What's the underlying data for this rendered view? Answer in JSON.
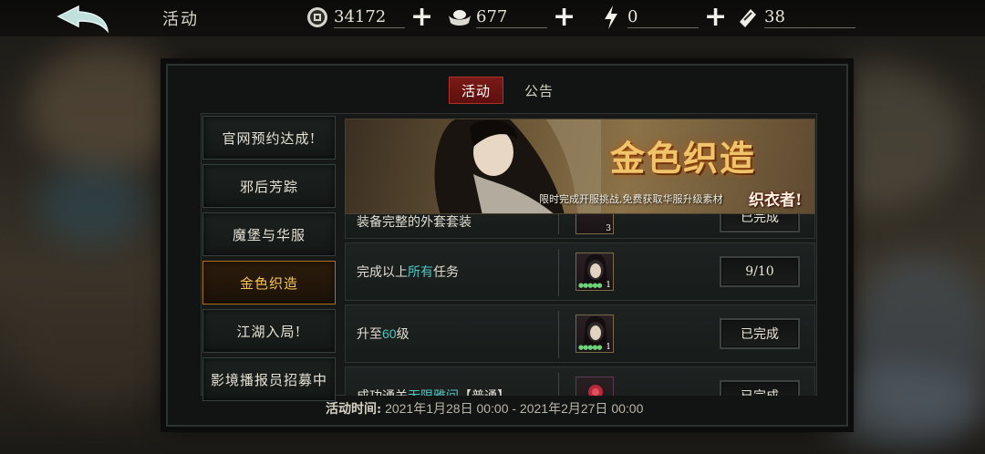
{
  "topbar": {
    "title": "活动",
    "resources": [
      {
        "icon": "coin-icon",
        "value": "34172"
      },
      {
        "icon": "silver-ingot-icon",
        "value": "677"
      },
      {
        "icon": "lightning-icon",
        "value": "0"
      },
      {
        "icon": "ticket-icon",
        "value": "38"
      }
    ],
    "plus_label": "+"
  },
  "tabs": [
    {
      "label": "活动",
      "active": true
    },
    {
      "label": "公告",
      "active": false
    }
  ],
  "sidebar": {
    "items": [
      {
        "label": "官网预约达成!",
        "active": false
      },
      {
        "label": "邪后芳踪",
        "active": false
      },
      {
        "label": "魔堡与华服",
        "active": false
      },
      {
        "label": "金色织造",
        "active": true
      },
      {
        "label": "江湖入局!",
        "active": false
      },
      {
        "label": "影境播报员招募中",
        "active": false
      }
    ]
  },
  "banner": {
    "title": "金色织造",
    "subtitle": "限时完成开服挑战,免费获取华服升级素材",
    "brand": "织衣者!"
  },
  "tasks": [
    {
      "desc_prefix": "装备完整的外套套装",
      "desc_highlight": "",
      "desc_suffix": "",
      "reward_count": "3",
      "status": "已完成"
    },
    {
      "desc_prefix": "完成以上",
      "desc_highlight": "所有",
      "desc_suffix": "任务",
      "reward_count": "1",
      "status": "9/10"
    },
    {
      "desc_prefix": "升至",
      "desc_highlight": "60",
      "desc_suffix": "级",
      "reward_count": "1",
      "status": "已完成"
    },
    {
      "desc_prefix": "成功通关",
      "desc_highlight": "无限雅间",
      "desc_suffix": "【普通】",
      "reward_count": "",
      "status": "已完成"
    }
  ],
  "footer": {
    "label": "活动时间:",
    "range": "2021年1月28日 00:00 - 2021年2月27日 00:00"
  },
  "colors": {
    "accent_gold": "#f2c35a",
    "tab_active_red": "#7a1a17",
    "highlight_teal": "#4fc7c0"
  }
}
